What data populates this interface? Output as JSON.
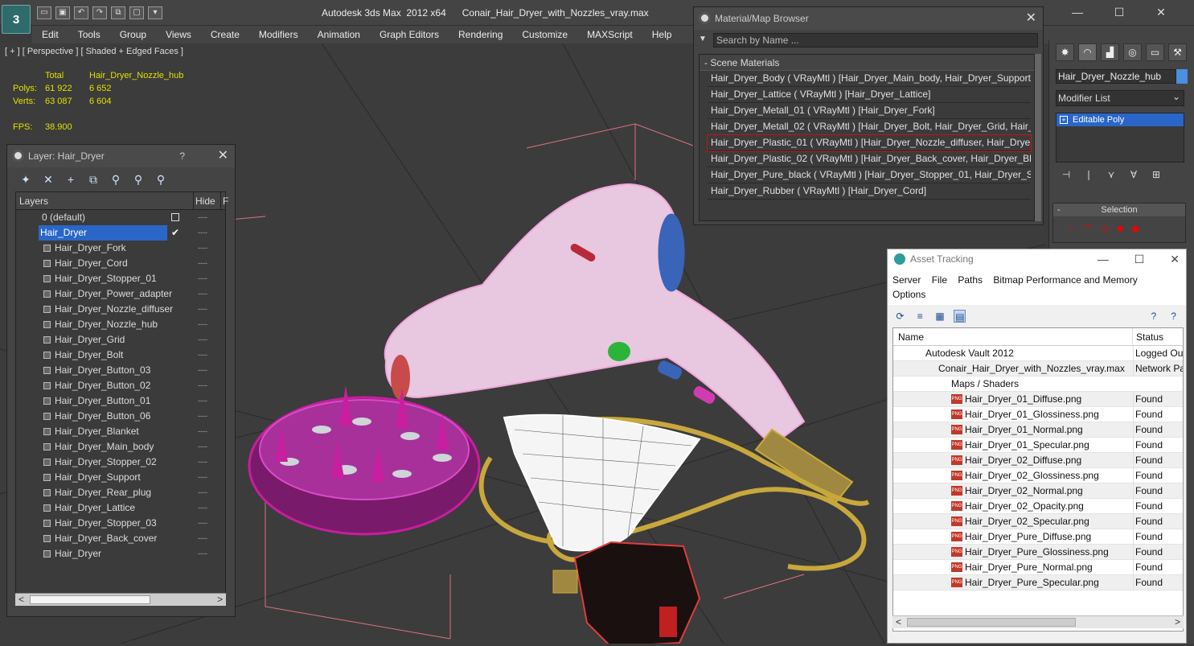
{
  "app": {
    "logo_text": "3",
    "title": "Autodesk 3ds Max  2012 x64      Conair_Hair_Dryer_with_Nozzles_vray.max",
    "win_min": "—",
    "win_max": "☐",
    "win_close": "✕"
  },
  "quick_access": [
    "▭",
    "▣",
    "↶",
    "↷",
    "⧉",
    "▢",
    "▾"
  ],
  "menu": [
    "Edit",
    "Tools",
    "Group",
    "Views",
    "Create",
    "Modifiers",
    "Animation",
    "Graph Editors",
    "Rendering",
    "Customize",
    "MAXScript",
    "Help"
  ],
  "viewport": {
    "label": "[ + ] [ Perspective ] [ Shaded + Edged Faces ]",
    "stats": {
      "total_label": "Total",
      "object_label": "Hair_Dryer_Nozzle_hub",
      "polys_label": "Polys:",
      "polys_total": "61 922",
      "polys_obj": "6 652",
      "verts_label": "Verts:",
      "verts_total": "63 087",
      "verts_obj": "6 604",
      "fps_label": "FPS:",
      "fps_value": "38.900"
    }
  },
  "layer_panel": {
    "title": "Layer: Hair_Dryer",
    "help": "?",
    "close": "✕",
    "toolbar_icons": [
      "✦",
      "✕",
      "+",
      "⧉",
      "⚲",
      "⚲",
      "⚲"
    ],
    "col_layers": "Layers",
    "col_hide": "Hide",
    "col_f": "F",
    "default_layer": "0 (default)",
    "active_layer": "Hair_Dryer",
    "check": "✔",
    "hide_mark": "----",
    "items": [
      "Hair_Dryer_Fork",
      "Hair_Dryer_Cord",
      "Hair_Dryer_Stopper_01",
      "Hair_Dryer_Power_adapter",
      "Hair_Dryer_Nozzle_diffuser",
      "Hair_Dryer_Nozzle_hub",
      "Hair_Dryer_Grid",
      "Hair_Dryer_Bolt",
      "Hair_Dryer_Button_03",
      "Hair_Dryer_Button_02",
      "Hair_Dryer_Button_01",
      "Hair_Dryer_Button_06",
      "Hair_Dryer_Blanket",
      "Hair_Dryer_Main_body",
      "Hair_Dryer_Stopper_02",
      "Hair_Dryer_Support",
      "Hair_Dryer_Rear_plug",
      "Hair_Dryer_Lattice",
      "Hair_Dryer_Stopper_03",
      "Hair_Dryer_Back_cover",
      "Hair_Dryer"
    ],
    "scroll_left": "<",
    "scroll_right": ">"
  },
  "material_browser": {
    "title": "Material/Map Browser",
    "close": "✕",
    "search_placeholder": "Search by Name ...",
    "group": "- Scene Materials",
    "items": [
      "Hair_Dryer_Body  ( VRayMtl )  [Hair_Dryer_Main_body, Hair_Dryer_Support]",
      "Hair_Dryer_Lattice  ( VRayMtl )  [Hair_Dryer_Lattice]",
      "Hair_Dryer_Metall_01  ( VRayMtl )  [Hair_Dryer_Fork]",
      "Hair_Dryer_Metall_02  ( VRayMtl )  [Hair_Dryer_Bolt, Hair_Dryer_Grid, Hair_...",
      "Hair_Dryer_Plastic_01  ( VRayMtl )  [Hair_Dryer_Nozzle_diffuser, Hair_Dryer...",
      "Hair_Dryer_Plastic_02  ( VRayMtl )  [Hair_Dryer_Back_cover, Hair_Dryer_Bla...",
      "Hair_Dryer_Pure_black  ( VRayMtl )  [Hair_Dryer_Stopper_01, Hair_Dryer_St...",
      "Hair_Dryer_Rubber  ( VRayMtl )  [Hair_Dryer_Cord]"
    ]
  },
  "command_panel": {
    "tabs": [
      "✸",
      "◠",
      "▟",
      "◎",
      "▭",
      "⚒"
    ],
    "object_name": "Hair_Dryer_Nozzle_hub",
    "modifier_list": "Modifier List",
    "modifier_arrow": "⌄",
    "stack_item": "Editable Poly",
    "stack_plus": "+",
    "stack_tools": [
      "⊣",
      "❘",
      "⋎",
      "∀",
      "⊞"
    ],
    "selection_title": "Selection",
    "selection_minus": "-",
    "selection_icons": [
      "∴",
      "⌒",
      "◇",
      "■",
      "◆"
    ]
  },
  "asset_tracking": {
    "title": "Asset Tracking",
    "ctl_min": "—",
    "ctl_max": "☐",
    "ctl_close": "✕",
    "menu": [
      "Server",
      "File",
      "Paths",
      "Bitmap Performance and Memory",
      "Options"
    ],
    "toolbar_icons": [
      "⟳",
      "≡",
      "▦",
      "▤",
      "?",
      "?"
    ],
    "col_name": "Name",
    "col_status": "Status",
    "rows": [
      {
        "name": "Autodesk Vault 2012",
        "status": "Logged Out"
      },
      {
        "name": "Conair_Hair_Dryer_with_Nozzles_vray.max",
        "status": "Network Path"
      },
      {
        "name": "Maps / Shaders",
        "status": ""
      },
      {
        "name": "Hair_Dryer_01_Diffuse.png",
        "status": "Found"
      },
      {
        "name": "Hair_Dryer_01_Glossiness.png",
        "status": "Found"
      },
      {
        "name": "Hair_Dryer_01_Normal.png",
        "status": "Found"
      },
      {
        "name": "Hair_Dryer_01_Specular.png",
        "status": "Found"
      },
      {
        "name": "Hair_Dryer_02_Diffuse.png",
        "status": "Found"
      },
      {
        "name": "Hair_Dryer_02_Glossiness.png",
        "status": "Found"
      },
      {
        "name": "Hair_Dryer_02_Normal.png",
        "status": "Found"
      },
      {
        "name": "Hair_Dryer_02_Opacity.png",
        "status": "Found"
      },
      {
        "name": "Hair_Dryer_02_Specular.png",
        "status": "Found"
      },
      {
        "name": "Hair_Dryer_Pure_Diffuse.png",
        "status": "Found"
      },
      {
        "name": "Hair_Dryer_Pure_Glossiness.png",
        "status": "Found"
      },
      {
        "name": "Hair_Dryer_Pure_Normal.png",
        "status": "Found"
      },
      {
        "name": "Hair_Dryer_Pure_Specular.png",
        "status": "Found"
      }
    ],
    "png_badge": "PNG",
    "scroll_left": "<",
    "scroll_right": ">"
  },
  "colors": {
    "selection_blue": "#2a66c8",
    "wire_pink": "#f2a6dc",
    "wire_magenta": "#c81ea0",
    "wire_gold": "#c8a83c",
    "wire_white": "#ffffff",
    "wire_red": "#e03c3c",
    "stats_yellow": "#e0e000"
  }
}
